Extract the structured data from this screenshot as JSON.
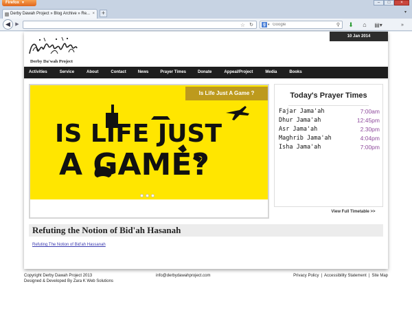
{
  "browser": {
    "app_button": "Firefox",
    "tab_title": "Derby Dawah Project » Blog Archive » Re...",
    "new_tab": "+",
    "search_placeholder": "Google",
    "window_controls": [
      "minimize",
      "maximize",
      "close"
    ]
  },
  "site": {
    "date": "10 Jan 2014",
    "logo_text": "Derby Da'wah Project",
    "nav": [
      "Activities",
      "Service",
      "About",
      "Contact",
      "News",
      "Prayer Times",
      "Donate",
      "Appeal/Project",
      "Media",
      "Books"
    ],
    "slider": {
      "caption": "Is Life Just A Game ?",
      "art_line1": "IS LIFE JUST",
      "art_line2": "A GAME?",
      "dots": 3
    },
    "prayer": {
      "heading": "Today's Prayer Times",
      "rows": [
        {
          "name": "Fajar Jama'ah",
          "time": "7:00am"
        },
        {
          "name": "Dhur Jama'ah",
          "time": "12:45pm"
        },
        {
          "name": "Asr Jama'ah",
          "time": "2.30pm"
        },
        {
          "name": "Maghrib Jama'ah",
          "time": "4:04pm"
        },
        {
          "name": "Isha Jama'ah",
          "time": "7:00pm"
        }
      ],
      "timetable_link": "View Full Timetable >>"
    },
    "post": {
      "title": "Refuting the Notion of Bid'ah Hasanah",
      "link": "Refuting The Notion of Bid'ah Hassanah"
    },
    "footer": {
      "copyright": "Copyright Derby Dawah Project 2013",
      "credit": "Designed & Developed By Zara K Web Solutions",
      "email": "info@derbydawahproject.com",
      "links": [
        "Privacy Policy",
        "Accessibility Statement",
        "Site Map"
      ]
    }
  },
  "colors": {
    "slide_bg": "#ffe600",
    "slide_caption_bg": "#bd9a1d",
    "nav_bg": "#1e1e1e",
    "prayer_time": "#8e4a9c",
    "firefox_button": "#e0661b"
  },
  "icons": [
    "back-arrow-icon",
    "forward-arrow-icon",
    "bookmark-star-icon",
    "reload-icon",
    "google-icon",
    "magnifier-icon",
    "download-arrow-icon",
    "home-icon",
    "bookmarks-icon",
    "menu-icon"
  ]
}
